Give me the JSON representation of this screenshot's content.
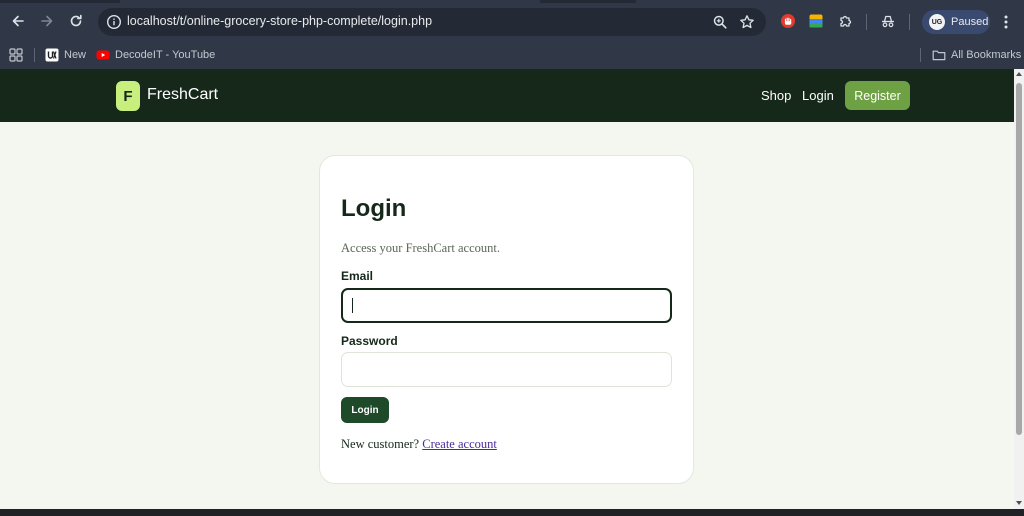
{
  "browser": {
    "url": "localhost/t/online-grocery-store-php-complete/login.php",
    "profile_status": "Paused",
    "profile_initials": "UG",
    "bookmarks": [
      {
        "label": "New",
        "icon": "uxpilot-icon"
      },
      {
        "label": "DecodeIT - YouTube",
        "icon": "youtube-icon"
      }
    ],
    "all_bookmarks_label": "All Bookmarks",
    "colors": {
      "frame": "#303746",
      "omnibox": "#242a35",
      "profile": "#3a4a6e"
    }
  },
  "site": {
    "logo_letter": "F",
    "brand": "FreshCart",
    "nav": {
      "shop": "Shop",
      "login": "Login",
      "register": "Register"
    },
    "colors": {
      "header": "#15281a",
      "logo_badge": "#c8ef7e",
      "register": "#6da143",
      "page_bg": "#f4f7f0"
    }
  },
  "login": {
    "title": "Login",
    "subtitle": "Access your FreshCart account.",
    "email_label": "Email",
    "email_value": "",
    "password_label": "Password",
    "password_value": "",
    "submit_label": "Login",
    "footer_text": "New customer?",
    "create_account_link": "Create account",
    "colors": {
      "submit": "#1e4a2a",
      "link": "#4b2b9a"
    }
  }
}
